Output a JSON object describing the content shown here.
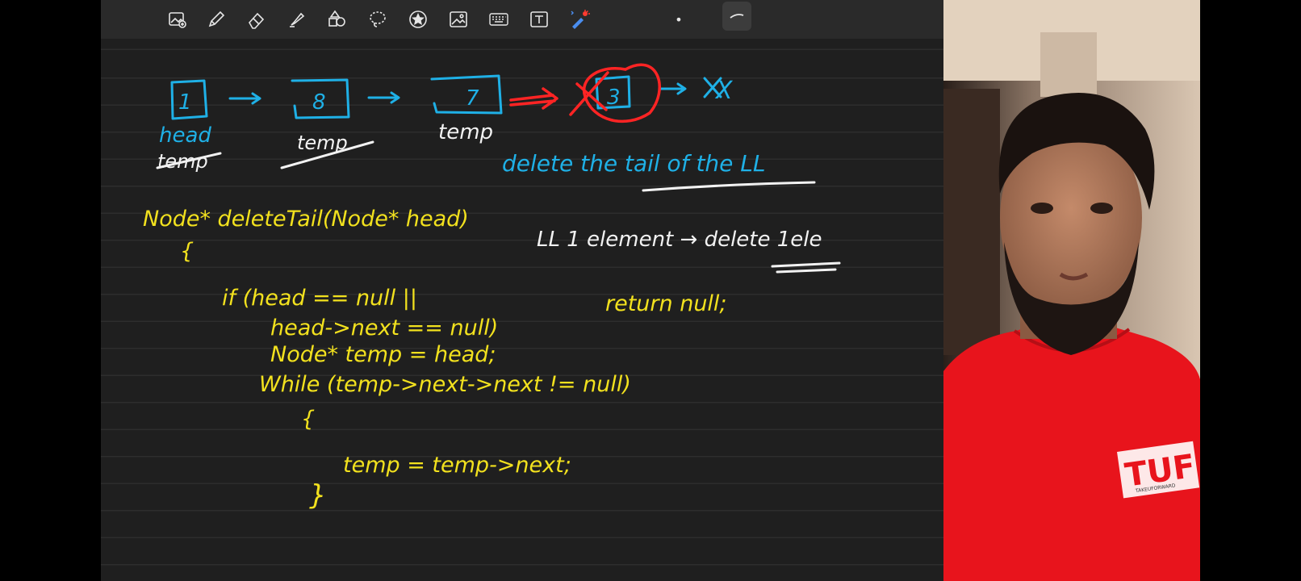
{
  "toolbar": {
    "tools": [
      {
        "name": "add-photo-icon"
      },
      {
        "name": "pen-icon"
      },
      {
        "name": "eraser-icon"
      },
      {
        "name": "highlighter-icon"
      },
      {
        "name": "shapes-icon"
      },
      {
        "name": "lasso-icon"
      },
      {
        "name": "sticker-icon"
      },
      {
        "name": "image-icon"
      },
      {
        "name": "keyboard-icon"
      },
      {
        "name": "text-box-icon"
      },
      {
        "name": "laser-pointer-icon"
      }
    ],
    "pen_size_dot": "•"
  },
  "linked_list": {
    "nodes": [
      "1",
      "8",
      "7",
      "3"
    ],
    "end": "X",
    "labels": {
      "head": "head",
      "temp_struck": "temp",
      "temp": "temp"
    }
  },
  "notes": {
    "heading": "delete the tail of the LL",
    "signature": "Node* deleteTail(Node* head)",
    "open_brace": "{",
    "side_note": "LL 1 element → delete 1ele",
    "if_line1": "if (head == null ||",
    "if_line2": "head->next == null)",
    "return_stmt": "return null;",
    "decl": "Node* temp = head;",
    "while_line": "While (temp->next->next != null)",
    "while_open": "{",
    "body": "temp = temp->next;",
    "while_close": "}"
  },
  "video": {
    "shirt_logo": "TUF",
    "shirt_tagline": "TAKEUFORWARD"
  },
  "colors": {
    "canvas": "#1f1f1f",
    "toolbar": "#2a2a2a",
    "blue_ink": "#1fb0e6",
    "yellow_ink": "#f2e11e",
    "white_ink": "#f2f2f2",
    "red_ink": "#ff2424"
  }
}
